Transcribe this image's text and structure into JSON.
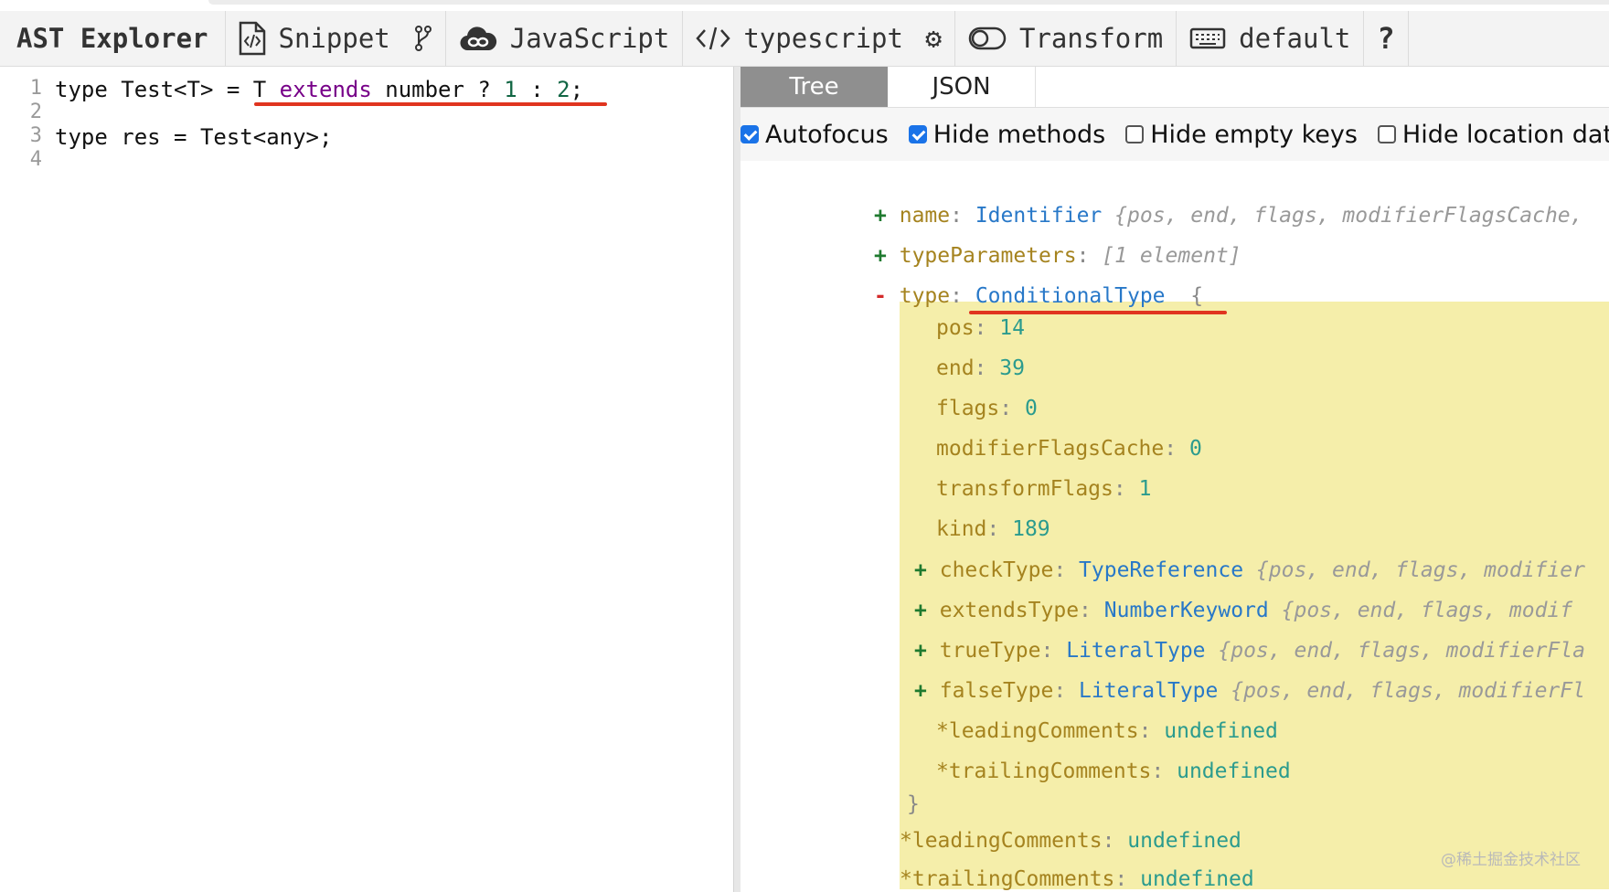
{
  "toolbar": {
    "brand": "AST Explorer",
    "snippet": "Snippet",
    "language": "JavaScript",
    "parser": "typescript",
    "transform": "Transform",
    "keymap": "default",
    "help": "?"
  },
  "editor": {
    "line_numbers": [
      "1",
      "2",
      "3",
      "4"
    ],
    "lines": {
      "l1_a": "type Test<T> = T ",
      "l1_kw": "extends",
      "l1_b": " number ? ",
      "l1_n1": "1",
      "l1_c": " : ",
      "l1_n2": "2",
      "l1_d": ";",
      "l3": "type res = Test<any>;"
    }
  },
  "panel": {
    "tabs": [
      "Tree",
      "JSON"
    ],
    "options": [
      {
        "label": "Autofocus",
        "checked": true
      },
      {
        "label": "Hide methods",
        "checked": true
      },
      {
        "label": "Hide empty keys",
        "checked": false
      },
      {
        "label": "Hide location data",
        "checked": false
      }
    ]
  },
  "tree": {
    "name": {
      "toggle": "+",
      "key": "name",
      "type": "Identifier",
      "summary": "{pos, end, flags, modifierFlagsCache,"
    },
    "typeParameters": {
      "toggle": "+",
      "key": "typeParameters",
      "summary": "[1 element]"
    },
    "type": {
      "toggle": "-",
      "key": "type",
      "type": "ConditionalType",
      "open": "{",
      "close": "}"
    },
    "props": [
      {
        "key": "pos",
        "value": "14"
      },
      {
        "key": "end",
        "value": "39"
      },
      {
        "key": "flags",
        "value": "0"
      },
      {
        "key": "modifierFlagsCache",
        "value": "0"
      },
      {
        "key": "transformFlags",
        "value": "1"
      },
      {
        "key": "kind",
        "value": "189"
      }
    ],
    "children": [
      {
        "toggle": "+",
        "key": "checkType",
        "type": "TypeReference",
        "summary": "{pos, end, flags, modifier"
      },
      {
        "toggle": "+",
        "key": "extendsType",
        "type": "NumberKeyword",
        "summary": "{pos, end, flags, modif"
      },
      {
        "toggle": "+",
        "key": "trueType",
        "type": "LiteralType",
        "summary": "{pos, end, flags, modifierFla"
      },
      {
        "toggle": "+",
        "key": "falseType",
        "type": "LiteralType",
        "summary": "{pos, end, flags, modifierFl"
      }
    ],
    "inner_comments": [
      {
        "key": "*leadingComments",
        "value": "undefined"
      },
      {
        "key": "*trailingComments",
        "value": "undefined"
      }
    ],
    "outer_comments": [
      {
        "key": "*leadingComments",
        "value": "undefined"
      },
      {
        "key": "*trailingComments",
        "value": "undefined"
      }
    ]
  },
  "watermark": "@稀土掘金技术社区",
  "colors": {
    "annotation_red": "#e0341f",
    "highlight": "#f5eeaa",
    "checkbox_blue": "#1a73e8"
  }
}
